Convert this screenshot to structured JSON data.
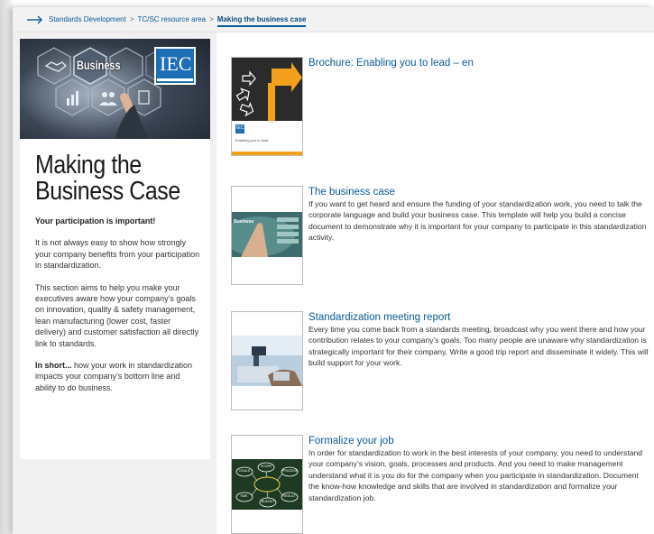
{
  "breadcrumb": {
    "items": [
      "Standards Development",
      "TC/SC resource area"
    ],
    "separator": ">",
    "current": "Making the business case"
  },
  "sidebar": {
    "hero_business_text": "Business",
    "hero_logo_text": "IEC",
    "title_line1": "Making the",
    "title_line2": "Business Case",
    "subtitle": "Your participation is important!",
    "paragraph1": "It is not always easy to show how strongly your company benefits from your participation in standardization.",
    "paragraph2": "This section aims to help you make your executives aware how your company’s goals on innovation, quality & safety management, lean manufacturing (lower cost, faster delivery) and customer satisfaction all directly link to standards.",
    "paragraph3_bold": "In short...",
    "paragraph3_rest": " how your work in standardization impacts your company’s bottom line and ability to do business."
  },
  "items": [
    {
      "title": "Brochure: Enabling you to lead – en",
      "description": "",
      "thumb_logo": "IEC",
      "thumb_caption": "Enabling you to lead"
    },
    {
      "title": "The business case",
      "description": "If you want to get heard and ensure the funding of your standardization work, you need to talk the corporate language and build your business case. This template will help you build a concise document to demonstrate why it is important for your company to participate in this standardization activity.",
      "thumb_label": "Business"
    },
    {
      "title": "Standardization meeting report",
      "description": "Every time you come back from a standards meeting, broadcast why you went there and how your contribution relates to your company’s goals. Too many people are unaware why standardization is strategically important for their company. Write a good trip report and disseminate it widely. This will build support for your work."
    },
    {
      "title": "Formalize your job",
      "description": "In order for standardization to work in the best interests of your company, you need to understand your company’s vision, goals, processes and products. And you need to make management understand what it is you do for the company when you participate in standardization. Document the know-how knowledge and skills that are involved in standardization and formalize your standardization job.",
      "thumb_words": [
        "GOALS",
        "SCOPE",
        "PROCESS",
        "TIME",
        "BUDGET",
        "RESULT"
      ]
    }
  ],
  "colors": {
    "link": "#0a5a94",
    "brochure_accent": "#f3a11c",
    "chalkboard": "#1f3a22",
    "iec_blue": "#1c6fb5"
  }
}
